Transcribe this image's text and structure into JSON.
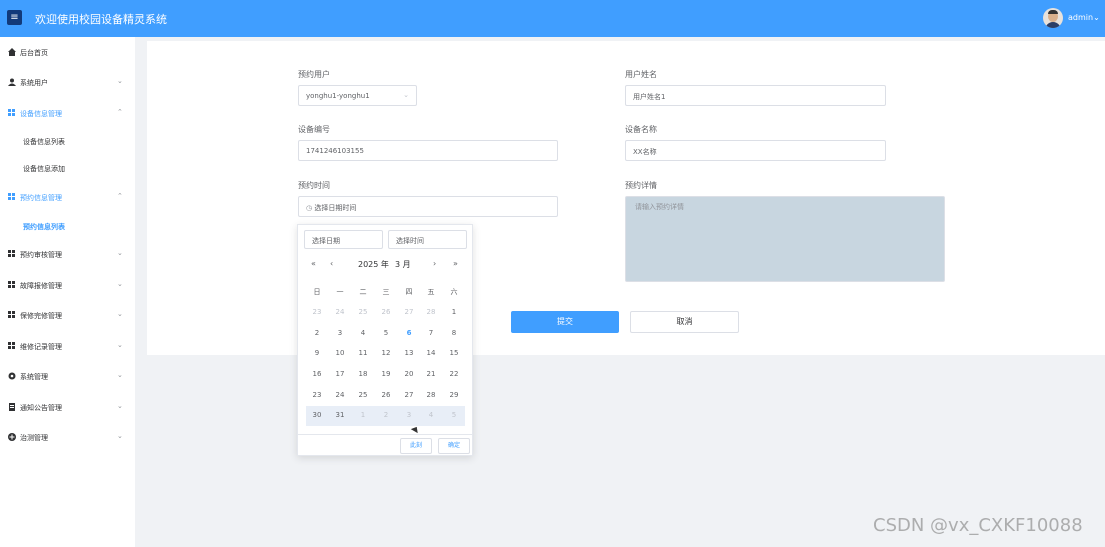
{
  "header": {
    "title": "欢迎使用校园设备精灵系统",
    "username": "admin",
    "menu_icon": "≡",
    "caret": "⌄"
  },
  "sidebar": {
    "items": [
      {
        "label": "后台首页",
        "icon": "home-icon",
        "chevron": ""
      },
      {
        "label": "系统用户",
        "icon": "user-icon",
        "chevron": "⌄"
      },
      {
        "label": "设备信息管理",
        "icon": "grid-icon",
        "chevron": "⌃"
      },
      {
        "label": "设备信息列表",
        "sub": true
      },
      {
        "label": "设备信息添加",
        "sub": true
      },
      {
        "label": "预约信息管理",
        "icon": "grid-icon",
        "chevron": "⌃"
      },
      {
        "label": "预约信息列表",
        "sub": true,
        "active": true
      },
      {
        "label": "预约审核管理",
        "icon": "grid-icon",
        "chevron": "⌄"
      },
      {
        "label": "故障报修管理",
        "icon": "grid-icon",
        "chevron": "⌄"
      },
      {
        "label": "保修完修管理",
        "icon": "grid-icon",
        "chevron": "⌄"
      },
      {
        "label": "维修记录管理",
        "icon": "grid-icon",
        "chevron": "⌄"
      },
      {
        "label": "系统管理",
        "icon": "gear-icon",
        "chevron": "⌄"
      },
      {
        "label": "通知公告管理",
        "icon": "doc-icon",
        "chevron": "⌄"
      },
      {
        "label": "治测管理",
        "icon": "plus-circle-icon",
        "chevron": "⌄"
      }
    ]
  },
  "form": {
    "user_label": "预约用户",
    "user_value": "yonghu1-yonghu1",
    "name_label": "用户姓名",
    "name_value": "用户姓名1",
    "device_no_label": "设备编号",
    "device_no_value": "1741246103155",
    "device_name_label": "设备名称",
    "device_name_value": "XX名称",
    "time_label": "预约时间",
    "time_placeholder": "选择日期时间",
    "detail_label": "预约详情",
    "detail_placeholder": "请输入预约详情",
    "submit": "提交",
    "cancel": "取消"
  },
  "picker": {
    "date_placeholder": "选择日期",
    "time_placeholder": "选择时间",
    "year": "2025 年",
    "month": "3 月",
    "prev_year": "«",
    "prev_month": "‹",
    "next_month": "›",
    "next_year": "»",
    "weekdays": [
      "日",
      "一",
      "二",
      "三",
      "四",
      "五",
      "六"
    ],
    "weeks": [
      [
        "23",
        "24",
        "25",
        "26",
        "27",
        "28",
        "1"
      ],
      [
        "2",
        "3",
        "4",
        "5",
        "6",
        "7",
        "8"
      ],
      [
        "9",
        "10",
        "11",
        "12",
        "13",
        "14",
        "15"
      ],
      [
        "16",
        "17",
        "18",
        "19",
        "20",
        "21",
        "22"
      ],
      [
        "23",
        "24",
        "25",
        "26",
        "27",
        "28",
        "29"
      ],
      [
        "30",
        "31",
        "1",
        "2",
        "3",
        "4",
        "5"
      ]
    ],
    "today": "6",
    "now_button": "此刻",
    "ok_button": "确定"
  },
  "watermark": "CSDN @vx_CXKF10088"
}
